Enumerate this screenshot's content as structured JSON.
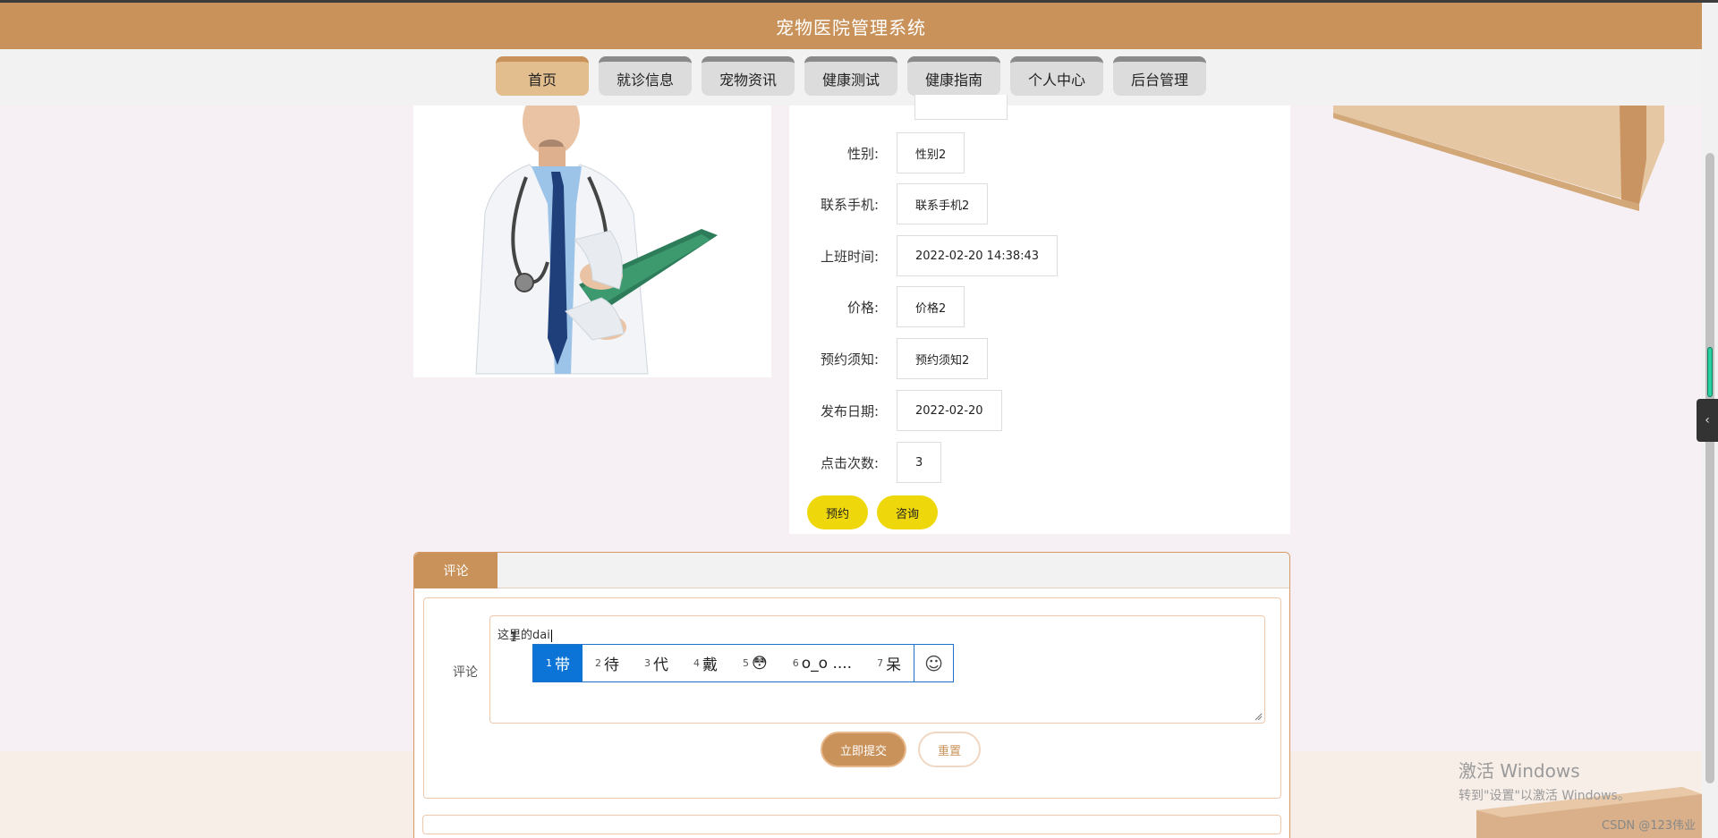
{
  "header": {
    "title": "宠物医院管理系统"
  },
  "nav": {
    "items": [
      {
        "label": "首页",
        "active": true
      },
      {
        "label": "就诊信息"
      },
      {
        "label": "宠物资讯"
      },
      {
        "label": "健康测试"
      },
      {
        "label": "健康指南"
      },
      {
        "label": "个人中心"
      },
      {
        "label": "后台管理"
      }
    ]
  },
  "details": {
    "fields": [
      {
        "label": "性别:",
        "value": "性别2"
      },
      {
        "label": "联系手机:",
        "value": "联系手机2"
      },
      {
        "label": "上班时间:",
        "value": "2022-02-20 14:38:43"
      },
      {
        "label": "价格:",
        "value": "价格2"
      },
      {
        "label": "预约须知:",
        "value": "预约须知2"
      },
      {
        "label": "发布日期:",
        "value": "2022-02-20"
      },
      {
        "label": "点击次数:",
        "value": "3"
      }
    ],
    "buttons": {
      "book": "预约",
      "consult": "咨询"
    }
  },
  "comment": {
    "tab_label": "评论",
    "field_label": "评论",
    "textarea_value": "这里的dai",
    "submit_label": "立即提交",
    "reset_label": "重置"
  },
  "ime": {
    "candidates": [
      {
        "num": "1",
        "text": "带"
      },
      {
        "num": "2",
        "text": "待"
      },
      {
        "num": "3",
        "text": "代"
      },
      {
        "num": "4",
        "text": "戴"
      },
      {
        "num": "5",
        "text": "😳"
      },
      {
        "num": "6",
        "text": "o_o ...."
      },
      {
        "num": "7",
        "text": "呆"
      }
    ],
    "emoji_button": "☺"
  },
  "watermark": {
    "line1": "激活 Windows",
    "line2": "转到\"设置\"以激活 Windows。",
    "credit": "CSDN @123伟业"
  },
  "colors": {
    "brand": "#c9925a",
    "action_yellow": "#eed70a",
    "ime_blue": "#0b74d6"
  }
}
